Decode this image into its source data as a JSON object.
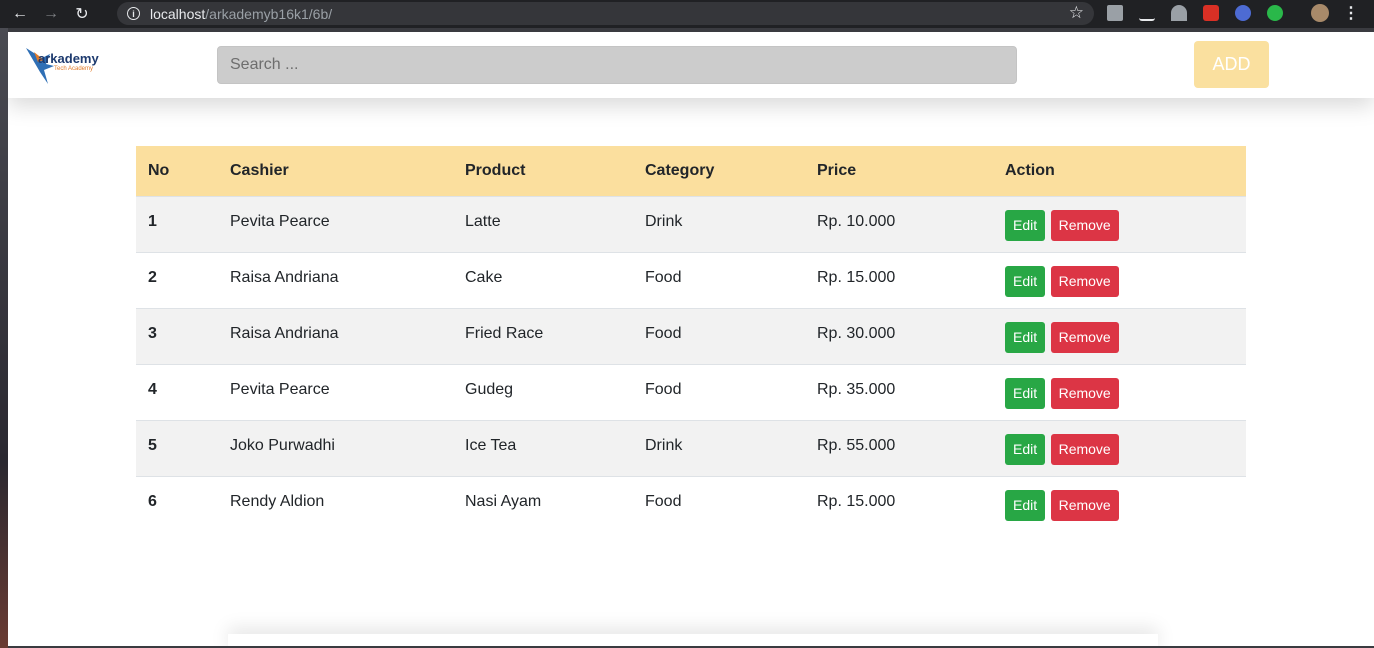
{
  "browser": {
    "url_host": "localhost",
    "url_path": "/arkademyb16k1/6b/"
  },
  "header": {
    "logo_text": "arkademy",
    "logo_subtext": "Tech Academy",
    "search_placeholder": "Search ...",
    "add_label": "ADD"
  },
  "table": {
    "headers": [
      "No",
      "Cashier",
      "Product",
      "Category",
      "Price",
      "Action"
    ],
    "rows": [
      {
        "no": "1",
        "cashier": "Pevita Pearce",
        "product": "Latte",
        "category": "Drink",
        "price": "Rp. 10.000"
      },
      {
        "no": "2",
        "cashier": "Raisa Andriana",
        "product": "Cake",
        "category": "Food",
        "price": "Rp. 15.000"
      },
      {
        "no": "3",
        "cashier": "Raisa Andriana",
        "product": "Fried Race",
        "category": "Food",
        "price": "Rp. 30.000"
      },
      {
        "no": "4",
        "cashier": "Pevita Pearce",
        "product": "Gudeg",
        "category": "Food",
        "price": "Rp. 35.000"
      },
      {
        "no": "5",
        "cashier": "Joko Purwadhi",
        "product": "Ice Tea",
        "category": "Drink",
        "price": "Rp. 55.000"
      },
      {
        "no": "6",
        "cashier": "Rendy Aldion",
        "product": "Nasi Ayam",
        "category": "Food",
        "price": "Rp. 15.000"
      }
    ],
    "edit_label": "Edit",
    "remove_label": "Remove"
  },
  "colors": {
    "header_bg": "#fbdf9e",
    "add_bg": "#fae09f",
    "edit_bg": "#28a745",
    "remove_bg": "#dc3545"
  },
  "icons": [
    "back-arrow-icon",
    "forward-arrow-icon",
    "reload-icon",
    "info-icon",
    "star-icon",
    "camera-icon",
    "menu-dots-icon"
  ]
}
